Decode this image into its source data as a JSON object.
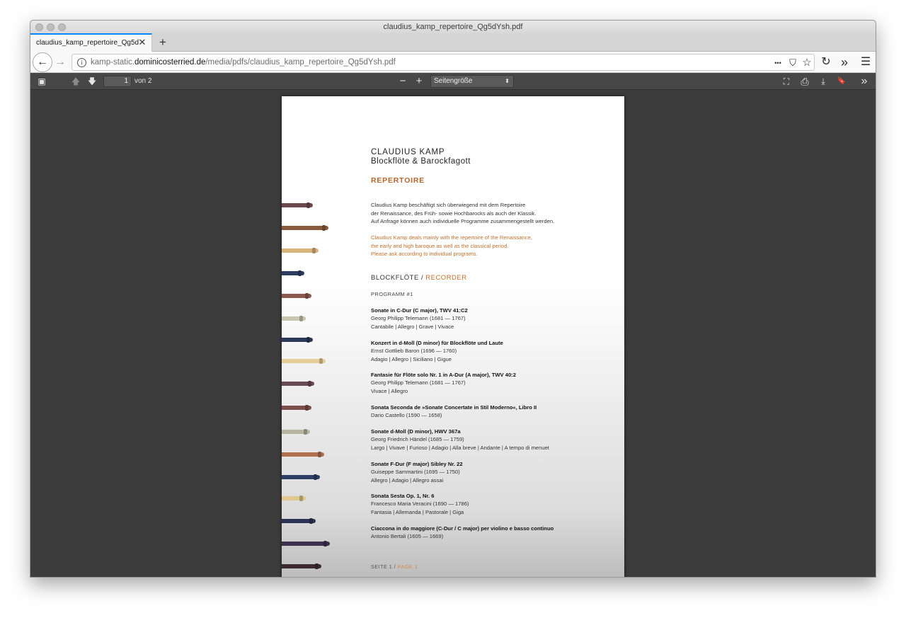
{
  "window": {
    "title": "claudius_kamp_repertoire_Qg5dYsh.pdf"
  },
  "tab": {
    "label": "claudius_kamp_repertoire_Qg5dYsh.pdf",
    "close_glyph": "✕",
    "new_tab_glyph": "+"
  },
  "nav": {
    "back_glyph": "←",
    "forward_glyph": "→",
    "info_glyph": "i",
    "url_prefix": "kamp-static.",
    "url_domain": "dominicosterried.de",
    "url_path": "/media/pdfs/claudius_kamp_repertoire_Qg5dYsh.pdf",
    "more_glyph": "•••",
    "pocket_glyph": "⛉",
    "star_glyph": "☆",
    "reload_glyph": "↻",
    "overflow_glyph": "»",
    "menu_glyph": "☰"
  },
  "pdf_toolbar": {
    "sidebar_glyph": "▣",
    "prev_glyph": "🡅",
    "next_glyph": "🡇",
    "page_number": "1",
    "page_of": "von 2",
    "zoom_out_glyph": "−",
    "zoom_in_glyph": "+",
    "zoom_value": "Seitengröße",
    "zoom_arrow": "⬍",
    "presentation_glyph": "⛶",
    "print_glyph": "⎙",
    "download_glyph": "⤓",
    "bookmark_glyph": "🔖",
    "tools_glyph": "»"
  },
  "document": {
    "name": "CLAUDIUS KAMP",
    "subtitle": "Blockflöte & Barockfagott",
    "heading": "REPERTOIRE",
    "de_lines": [
      "Claudius Kamp beschäftigt sich überwiegend mit dem Repertoire",
      "der Renaissance, des Früh- sowie Hochbarocks als auch der Klassik.",
      "Auf Anfrage können auch individuelle Programme zusammengestellt werden."
    ],
    "en_lines": [
      "Claudius Kamp deals mainly with the repertoire of the Renaissance,",
      "the early and high baroque as well as the classical period.",
      "Please ask according to individual programs."
    ],
    "section_de": "BLOCKFLÖTE / ",
    "section_en": "RECORDER",
    "program": "PROGRAMM #1",
    "works": [
      {
        "title": "Sonate in C-Dur (C major), TWV 41:C2",
        "composer": "Georg Philipp Telemann (1681 — 1767)",
        "movements": "Cantabile | Allegro | Grave | Vivace"
      },
      {
        "title": "Konzert in d-Moll (D minor) für Blockflöte und Laute",
        "composer": "Ernst Gottlieb Baron (1696 — 1760)",
        "movements": "Adagio | Allegro | Siciliano | Gigue"
      },
      {
        "title": "Fantasie für Flöte solo Nr. 1 in A-Dur (A major), TWV 40:2",
        "composer": "Georg Philipp Telemann (1681 — 1767)",
        "movements": "Vivace | Allegro"
      },
      {
        "title": "Sonata Seconda de »Sonate Concertate in Stil Moderno«, Libro II",
        "composer": "Dario Castello (1590 — 1658)",
        "movements": ""
      },
      {
        "title": "Sonate d-Moll (D minor), HWV 367a",
        "composer": "Georg Friedrich Händel (1685 — 1759)",
        "movements": "Largo | Vivave | Furioso | Adagio | Alla breve | Andante | A tempo di menuet"
      },
      {
        "title": "Sonate F-Dur (F major) Sibley Nr. 22",
        "composer": "Guiseppe Sammartini (1695 — 1750)",
        "movements": "Allegro | Adagio | Allegro assai"
      },
      {
        "title": "Sonata Sesta Op. 1, Nr. 6",
        "composer": "Francesco Maria Veracini (1690 — 1786)",
        "movements": "Fantasia | Allemanda | Pastorale | Giga"
      },
      {
        "title": "Ciaccona in do maggiore (C-Dur / C major) per violino e basso continuo",
        "composer": "Antonio Bertali (1605 — 1669)",
        "movements": ""
      }
    ],
    "footer_de": "SEITE 1 / ",
    "footer_en": "PAGE 1"
  },
  "flute_colors": [
    "#6b4a4f",
    "#8a5a3c",
    "#d9b57a",
    "#2f3d63",
    "#8c5a4e",
    "#c9c6b0",
    "#2b3a5a",
    "#e6cf97",
    "#6a4a55",
    "#7a4f4e",
    "#b8b6a0",
    "#b07050",
    "#2d3f66",
    "#e0c88f",
    "#2b3552",
    "#3b3050",
    "#3a2a30"
  ]
}
